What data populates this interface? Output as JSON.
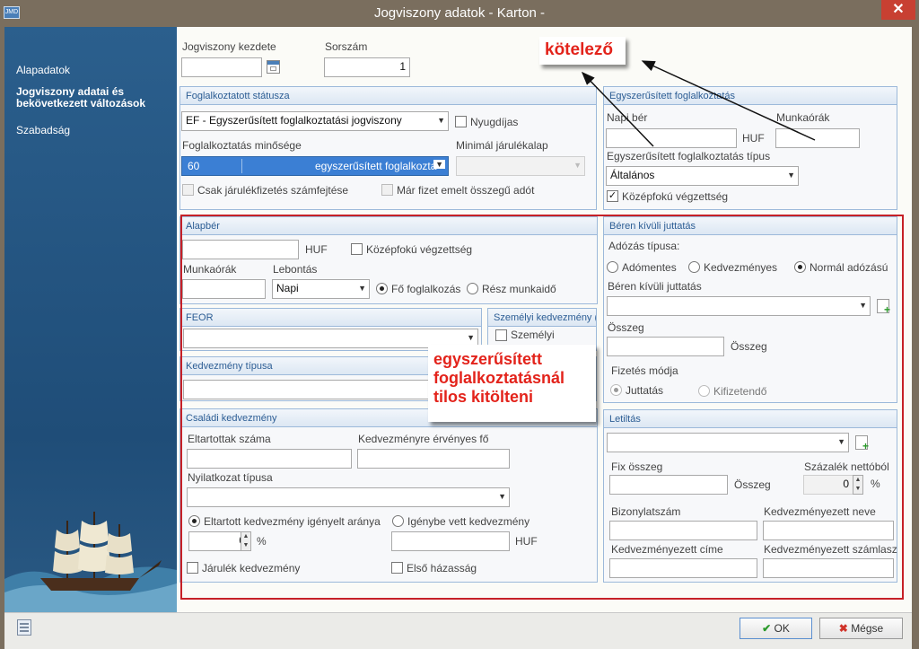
{
  "window": {
    "title": "Jogviszony adatok - Karton  -",
    "app_icon_text": "JMD",
    "close_label": "✕"
  },
  "sidebar": {
    "items": [
      {
        "label": "Alapadatok"
      },
      {
        "label": "Jogviszony adatai és"
      },
      {
        "label": "bekövetkezett változások"
      },
      {
        "label": "Szabadság"
      }
    ]
  },
  "top": {
    "start_label": "Jogviszony kezdete",
    "start_value": "",
    "seq_label": "Sorszám",
    "seq_value": "1"
  },
  "status_panel": {
    "title": "Foglalkoztatott státusza",
    "status_value": "EF - Egyszerűsített foglalkoztatási jogviszony",
    "pension_label": "Nyugdíjas",
    "quality_label": "Foglalkoztatás minősége",
    "quality_code": "60",
    "quality_text": "egyszerűsített foglalkozta",
    "min_base_label": "Minimál járulékalap",
    "contrib_only_label": "Csak járulékfizetés számfejtése",
    "higher_tax_label": "Már fizet emelt összegű adót"
  },
  "simple_panel": {
    "title": "Egyszerűsített foglalkoztatás",
    "daily_wage_label": "Napi bér",
    "daily_wage_unit": "HUF",
    "hours_label": "Munkaórák",
    "type_label": "Egyszerűsített foglalkoztatás típus",
    "type_value": "Általános",
    "secondary_edu_label": "Középfokú végzettség",
    "secondary_edu_checked": "✓"
  },
  "base_panel": {
    "title": "Alapbér",
    "unit": "HUF",
    "secondary_edu_label": "Középfokú végzettség",
    "hours_label": "Munkaórák",
    "breakdown_label": "Lebontás",
    "breakdown_value": "Napi",
    "main_job_label": "Fő foglalkozás",
    "part_time_label": "Rész munkaidő"
  },
  "feor_panel": {
    "title": "FEOR"
  },
  "personal_panel": {
    "title": "Személyi kedvezmény (",
    "personal_label": "Személyi"
  },
  "benefit_type_panel": {
    "title": "Kedvezmény típusa"
  },
  "family_panel": {
    "title": "Családi kedvezmény",
    "dependents_label": "Eltartottak száma",
    "eligible_label": "Kedvezményre érvényes fő",
    "declaration_label": "Nyilatkozat típusa",
    "ratio_label": "Eltartott kedvezmény igényelt aránya",
    "ratio_value": "0",
    "ratio_unit": "%",
    "used_label": "Igénybe vett kedvezmény",
    "used_unit": "HUF",
    "contrib_benefit_label": "Járulék kedvezmény",
    "first_marriage_label": "Első házasság"
  },
  "fringe_panel": {
    "title": "Béren kívüli juttatás",
    "tax_type_label": "Adózás típusa:",
    "tax_free_label": "Adómentes",
    "preferential_label": "Kedvezményes",
    "normal_label": "Normál adózású",
    "benefit_label": "Béren kívüli juttatás",
    "amount_label": "Összeg",
    "amount_unit": "Összeg",
    "payment_label": "Fizetés módja",
    "allowance_label": "Juttatás",
    "payable_label": "Kifizetendő"
  },
  "garnish_panel": {
    "title": "Letiltás",
    "fixed_label": "Fix összeg",
    "fixed_unit": "Összeg",
    "percent_label": "Százalék nettóból",
    "percent_value": "0",
    "percent_unit": "%",
    "doc_no_label": "Bizonylatszám",
    "beneficiary_name_label": "Kedvezményezett neve",
    "beneficiary_addr_label": "Kedvezményezett címe",
    "beneficiary_acc_label": "Kedvezményezett számlasz"
  },
  "annotations": {
    "required": "kötelező",
    "forbidden_line1": "egyszerűsített",
    "forbidden_line2": "foglalkoztatásnál",
    "forbidden_line3": "tilos kitölteni"
  },
  "footer": {
    "ok_label": "OK",
    "cancel_label": "Mégse"
  },
  "colors": {
    "accent": "#2c5d94",
    "annotation_red": "#e3231b",
    "frame": "#7a6e5e",
    "sidebar": "#1f4d78"
  }
}
